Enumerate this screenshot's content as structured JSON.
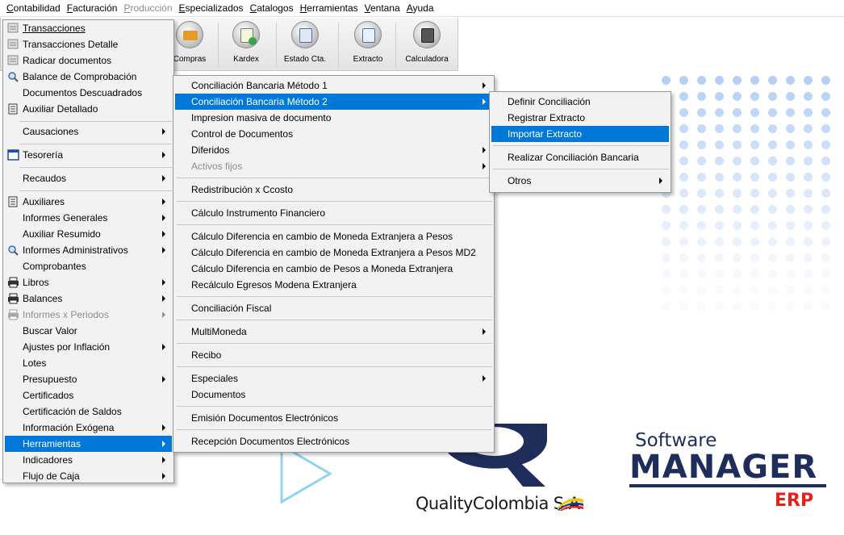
{
  "menubar": [
    {
      "label": "Contabilidad",
      "disabled": false
    },
    {
      "label": "Facturación",
      "disabled": false
    },
    {
      "label": "Producción",
      "disabled": true
    },
    {
      "label": "Especializados",
      "disabled": false
    },
    {
      "label": "Catalogos",
      "disabled": false
    },
    {
      "label": "Herramientas",
      "disabled": false
    },
    {
      "label": "Ventana",
      "disabled": false
    },
    {
      "label": "Ayuda",
      "disabled": false
    }
  ],
  "toolbar": {
    "compras": "Compras",
    "kardex": "Kardex",
    "estado_cta": "Estado Cta.",
    "extracto": "Extracto",
    "calculadora": "Calculadora"
  },
  "menu1": {
    "items": [
      {
        "label": "Transacciones",
        "icon": "document-icon"
      },
      {
        "label": "Transacciones Detalle",
        "icon": "document-icon"
      },
      {
        "label": "Radicar documentos",
        "icon": "document-icon"
      },
      {
        "label": "Balance de Comprobación",
        "icon": "magnifier-icon"
      },
      {
        "label": "Documentos Descuadrados",
        "icon": ""
      },
      {
        "label": "Auxiliar Detallado",
        "icon": "ledger-icon"
      },
      {
        "label": "Causaciones",
        "icon": ""
      },
      {
        "label": "Tesorería",
        "icon": "window-icon"
      },
      {
        "label": "Recaudos",
        "icon": ""
      },
      {
        "label": "Auxiliares",
        "icon": "ledger-icon"
      },
      {
        "label": "Informes Generales",
        "icon": ""
      },
      {
        "label": "Auxiliar Resumido",
        "icon": ""
      },
      {
        "label": "Informes Administrativos",
        "icon": "magnifier-icon"
      },
      {
        "label": "Comprobantes",
        "icon": ""
      },
      {
        "label": "Libros",
        "icon": "printer-icon"
      },
      {
        "label": "Balances",
        "icon": "printer-icon"
      },
      {
        "label": "Informes x Periodos",
        "icon": "printer-icon"
      },
      {
        "label": "Buscar Valor",
        "icon": ""
      },
      {
        "label": "Ajustes por Inflación",
        "icon": ""
      },
      {
        "label": "Lotes",
        "icon": ""
      },
      {
        "label": "Presupuesto",
        "icon": ""
      },
      {
        "label": "Certificados",
        "icon": ""
      },
      {
        "label": "Certificación de Saldos",
        "icon": ""
      },
      {
        "label": "Información Exógena",
        "icon": ""
      },
      {
        "label": "Herramientas",
        "icon": ""
      },
      {
        "label": "Indicadores",
        "icon": ""
      },
      {
        "label": "Flujo de Caja",
        "icon": ""
      }
    ]
  },
  "menu2": {
    "items": [
      "Conciliación Bancaria  Método 1",
      "Conciliación Bancaria Método 2",
      "Impresion masiva de documento",
      "Control de Documentos",
      "Diferidos",
      "Activos fijos",
      "Redistribución x Ccosto",
      "Cálculo Instrumento Financiero",
      "Cálculo Diferencia en cambio de Moneda Extranjera a Pesos",
      "Cálculo Diferencia en cambio de Moneda Extranjera a Pesos MD2",
      "Cálculo Diferencia en cambio de Pesos a Moneda Extranjera",
      "Recálculo Egresos Modena Extranjera",
      "Conciliación Fiscal",
      "MultiMoneda",
      "Recibo",
      "Especiales",
      "Documentos",
      "Emisión Documentos Electrónicos",
      "Recepción Documentos Electrónicos"
    ]
  },
  "menu3": {
    "items": [
      "Definir Conciliación",
      "Registrar Extracto",
      "Importar Extracto",
      "Realizar Conciliación Bancaria",
      "Otros"
    ]
  },
  "branding": {
    "quality": "QualityColombia S.A",
    "software": "Software",
    "manager": "MANAGER",
    "erp": "ERP"
  },
  "colors": {
    "selection": "#0078d7",
    "brand_navy": "#1f2d5a",
    "brand_red": "#e2231a"
  }
}
